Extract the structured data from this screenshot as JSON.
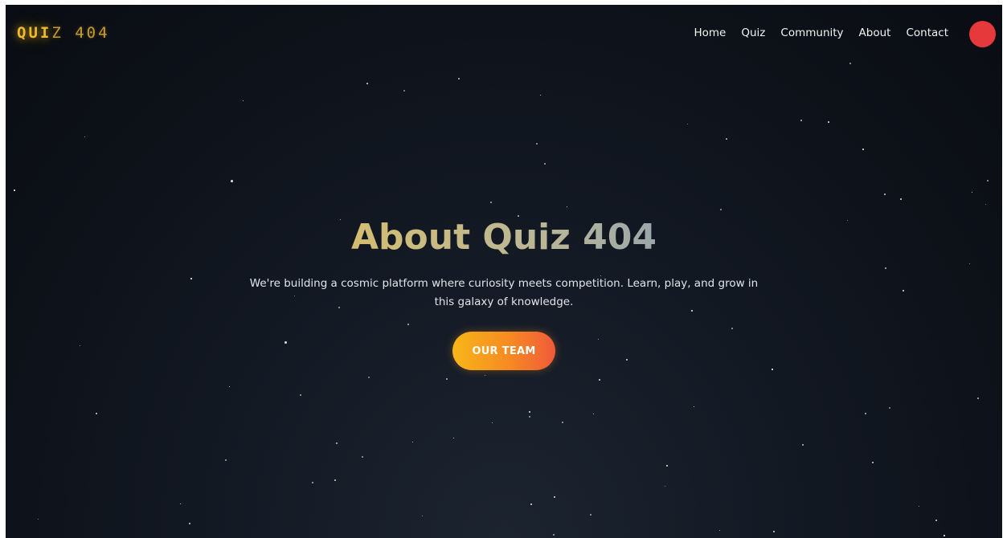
{
  "logo": {
    "bold": "QUI",
    "light": "Z 404",
    "glyph": "▯"
  },
  "nav": {
    "items": [
      "Home",
      "Quiz",
      "Community",
      "About",
      "Contact"
    ],
    "avatar_color": "#e5393b"
  },
  "hero": {
    "title": "About Quiz 404",
    "subtitle": "We're building a cosmic platform where curiosity meets competition. Learn, play, and grow in this galaxy of knowledge.",
    "cta_label": "OUR TEAM"
  },
  "colors": {
    "background": "#0c1017",
    "accent_gold": "#f2b928",
    "title_gradient": [
      "#e2b640",
      "#4e82d8"
    ],
    "cta_gradient": [
      "#f7b618",
      "#ef5a3a"
    ]
  }
}
